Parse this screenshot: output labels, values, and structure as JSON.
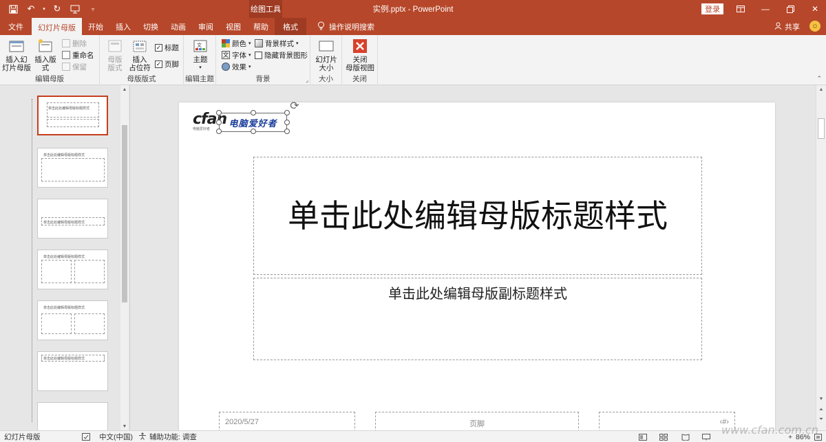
{
  "titlebar": {
    "context_tool": "绘图工具",
    "window_title": "实例.pptx  -  PowerPoint",
    "login_label": "登录"
  },
  "tabs": [
    {
      "label": "文件"
    },
    {
      "label": "幻灯片母版"
    },
    {
      "label": "开始"
    },
    {
      "label": "插入"
    },
    {
      "label": "切换"
    },
    {
      "label": "动画"
    },
    {
      "label": "审阅"
    },
    {
      "label": "视图"
    },
    {
      "label": "帮助"
    },
    {
      "label": "格式"
    }
  ],
  "tellme": "操作说明搜索",
  "share": "共享",
  "ribbon": {
    "edit_master": {
      "label": "编辑母版",
      "insert_slide_master": "插入幻\n灯片母版",
      "insert_layout": "插入版式",
      "delete": "删除",
      "rename": "重命名",
      "preserve": "保留"
    },
    "master_layout": {
      "label": "母版版式",
      "master_layout_btn": "母版\n版式",
      "insert_placeholder": "插入\n占位符",
      "title_chk": "标题",
      "footer_chk": "页脚"
    },
    "edit_theme": {
      "label": "编辑主题",
      "themes": "主题"
    },
    "background": {
      "label": "背景",
      "colors": "颜色",
      "fonts": "字体",
      "effects": "效果",
      "bg_styles": "背景样式",
      "hide_bg": "隐藏背景图形"
    },
    "size": {
      "label": "大小",
      "slide_size": "幻灯片\n大小"
    },
    "close": {
      "label": "关闭",
      "close_master": "关闭\n母版视图"
    }
  },
  "slide": {
    "logo_text": "cfan",
    "logo_sub": "电脑爱好者",
    "selected_text": "电脑爱好者",
    "title": "单击此处编辑母版标题样式",
    "subtitle": "单击此处编辑母版副标题样式",
    "footer_date": "2020/5/27",
    "footer_text": "页脚",
    "footer_num": "‹#›"
  },
  "thumbnails": [
    {
      "text": "单击此处编辑母版标题样式"
    },
    {
      "text": "单击此处编辑母版标题样式"
    },
    {
      "text": "单击此处编辑母版标题样式"
    },
    {
      "text": "单击此处编辑母版标题样式"
    },
    {
      "text": "单击此处编辑母版标题样式"
    },
    {
      "text": "单击此处编辑母版标题样式"
    }
  ],
  "statusbar": {
    "view": "幻灯片母版",
    "language": "中文(中国)",
    "accessibility": "辅助功能: 调查",
    "zoom": "86%"
  },
  "watermark": "www.cfan.com.cn",
  "colors": {
    "accent": "#b7472a",
    "context_tab": "#9e3b22",
    "selection_border": "#c43e1c"
  }
}
